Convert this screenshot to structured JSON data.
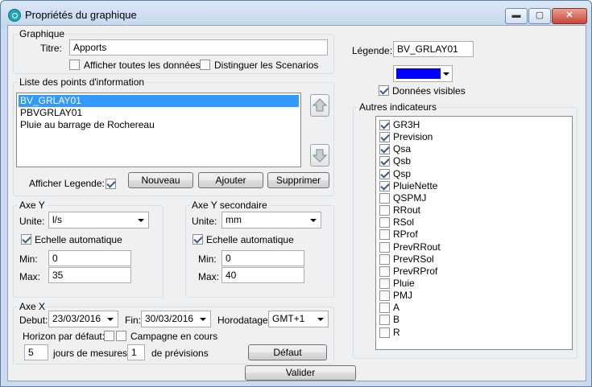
{
  "window": {
    "title": "Propriétés du graphique",
    "min_label": "▬",
    "max_label": "▢",
    "close_label": "✕"
  },
  "graphique": {
    "group_label": "Graphique",
    "titre_label": "Titre:",
    "titre_value": "Apports",
    "afficher_toutes_label": "Afficher toutes les données",
    "afficher_toutes_checked": false,
    "distinguer_label": "Distinguer les Scenarios",
    "distinguer_checked": false
  },
  "liste": {
    "group_label": "Liste des points d'information",
    "items": [
      "BV_GRLAY01",
      "PBVGRLAY01",
      "Pluie au barrage de Rochereau"
    ],
    "selected_index": 0,
    "afficher_legende_label": "Afficher Legende:",
    "afficher_legende_checked": true,
    "nouveau_label": "Nouveau",
    "ajouter_label": "Ajouter",
    "supprimer_label": "Supprimer"
  },
  "axe_y": {
    "group_label": "Axe Y",
    "unite_label": "Unite:",
    "unite_value": "l/s",
    "echelle_label": "Echelle automatique",
    "echelle_checked": true,
    "min_label": "Min:",
    "min_value": "0",
    "max_label": "Max:",
    "max_value": "35"
  },
  "axe_y2": {
    "group_label": "Axe Y secondaire",
    "unite_label": "Unite:",
    "unite_value": "mm",
    "echelle_label": "Echelle automatique",
    "echelle_checked": true,
    "min_label": "Min:",
    "min_value": "0",
    "max_label": "Max:",
    "max_value": "40"
  },
  "axe_x": {
    "group_label": "Axe X",
    "debut_label": "Debut:",
    "debut_value": "23/03/2016",
    "fin_label": "Fin:",
    "fin_value": "30/03/2016",
    "horodatage_label": "Horodatage :",
    "horodatage_value": "GMT+1",
    "horizon_label": "Horizon par défaut:",
    "horizon_checked": false,
    "campagne_label": "Campagne en cours",
    "campagne_checked": false,
    "jours_value": "5",
    "jours_label": "jours de mesures et",
    "previsions_value": "1",
    "previsions_label": "de prévisions",
    "defaut_label": "Défaut"
  },
  "legende": {
    "label": "Légende:",
    "value": "BV_GRLAY01",
    "color": "#0000ff",
    "donnees_visibles_label": "Données visibles",
    "donnees_visibles_checked": true
  },
  "autres": {
    "group_label": "Autres indicateurs",
    "items": [
      {
        "label": "GR3H",
        "checked": true
      },
      {
        "label": "Prevision",
        "checked": true
      },
      {
        "label": "Qsa",
        "checked": true
      },
      {
        "label": "Qsb",
        "checked": true
      },
      {
        "label": "Qsp",
        "checked": true
      },
      {
        "label": "PluieNette",
        "checked": true
      },
      {
        "label": "QSPMJ",
        "checked": false
      },
      {
        "label": "RRout",
        "checked": false
      },
      {
        "label": "RSol",
        "checked": false
      },
      {
        "label": "RProf",
        "checked": false
      },
      {
        "label": "PrevRRout",
        "checked": false
      },
      {
        "label": "PrevRSol",
        "checked": false
      },
      {
        "label": "PrevRProf",
        "checked": false
      },
      {
        "label": "Pluie",
        "checked": false
      },
      {
        "label": "PMJ",
        "checked": false
      },
      {
        "label": "A",
        "checked": false
      },
      {
        "label": "B",
        "checked": false
      },
      {
        "label": "R",
        "checked": false
      }
    ]
  },
  "valider_label": "Valider"
}
